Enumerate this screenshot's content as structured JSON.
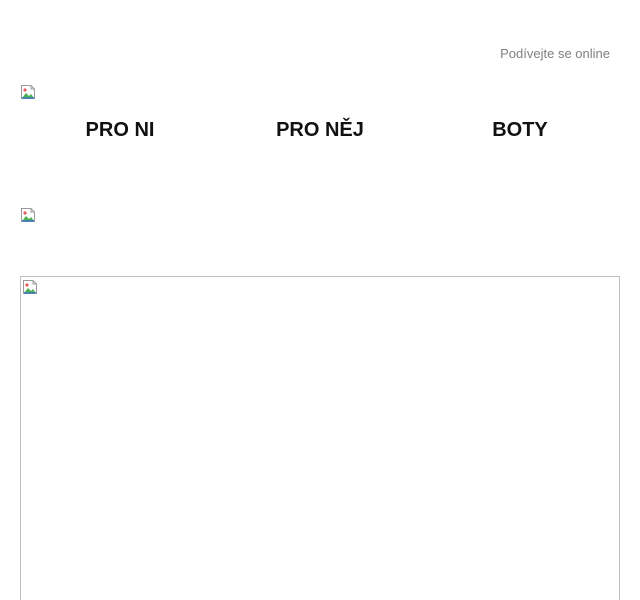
{
  "header": {
    "view_online_label": "Podívejte se online"
  },
  "nav": {
    "items": [
      {
        "label": "PRO NI"
      },
      {
        "label": "PRO NĚJ"
      },
      {
        "label": "BOTY"
      }
    ]
  },
  "icons": {
    "logo": "broken-image-icon",
    "banner": "broken-image-icon",
    "hero": "broken-image-icon"
  },
  "colors": {
    "link_gray": "#808080",
    "nav_text": "#111111",
    "frame_border": "#c0c0c0"
  }
}
